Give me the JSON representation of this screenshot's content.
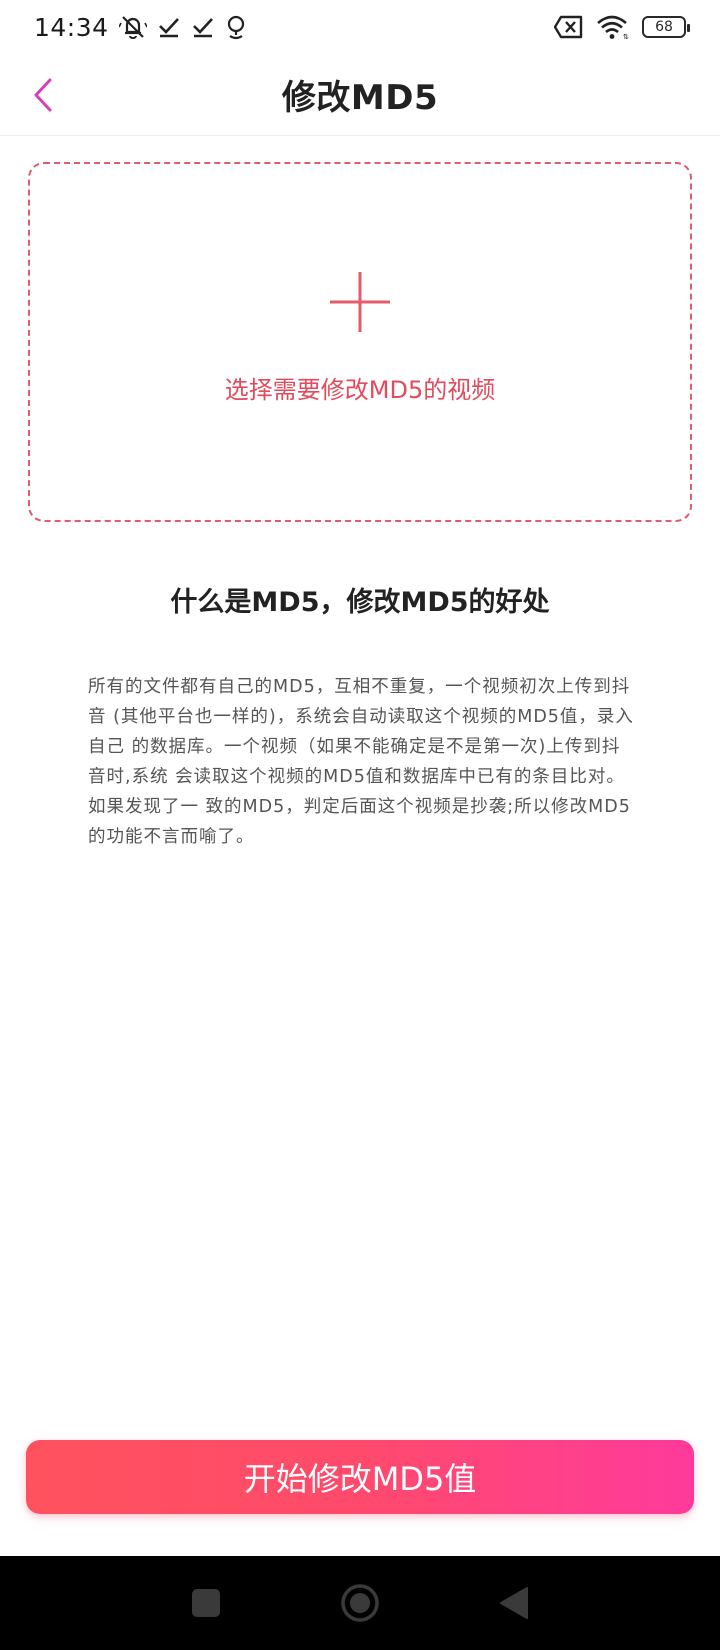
{
  "status_bar": {
    "time": "14:34",
    "battery": "68",
    "icons": [
      "mute-bell-icon",
      "check-icon",
      "check-icon",
      "location-icon",
      "sim-error-icon",
      "wifi-icon",
      "battery-icon"
    ]
  },
  "header": {
    "title": "修改MD5",
    "back_icon": "chevron-left-icon",
    "accent_color": "#d63fb7"
  },
  "upload": {
    "label": "选择需要修改MD5的视频",
    "icon": "plus-icon",
    "border_color": "#e35b69",
    "text_color": "#e34a5b"
  },
  "info": {
    "title": "什么是MD5，修改MD5的好处",
    "body": "所有的文件都有自己的MD5，互相不重复，一个视频初次上传到抖音 (其他平台也一样的)，系统会自动读取这个视频的MD5值，录入自己 的数据库。一个视频（如果不能确定是不是第一次)上传到抖音时,系统 会读取这个视频的MD5值和数据库中已有的条目比对。如果发现了一 致的MD5，判定后面这个视频是抄袭;所以修改MD5的功能不言而喻了。"
  },
  "action": {
    "label": "开始修改MD5值",
    "gradient_start": "#ff525e",
    "gradient_end": "#ff3a9c"
  },
  "nav": {
    "icons": [
      "recent-apps-icon",
      "home-icon",
      "back-triangle-icon"
    ]
  }
}
